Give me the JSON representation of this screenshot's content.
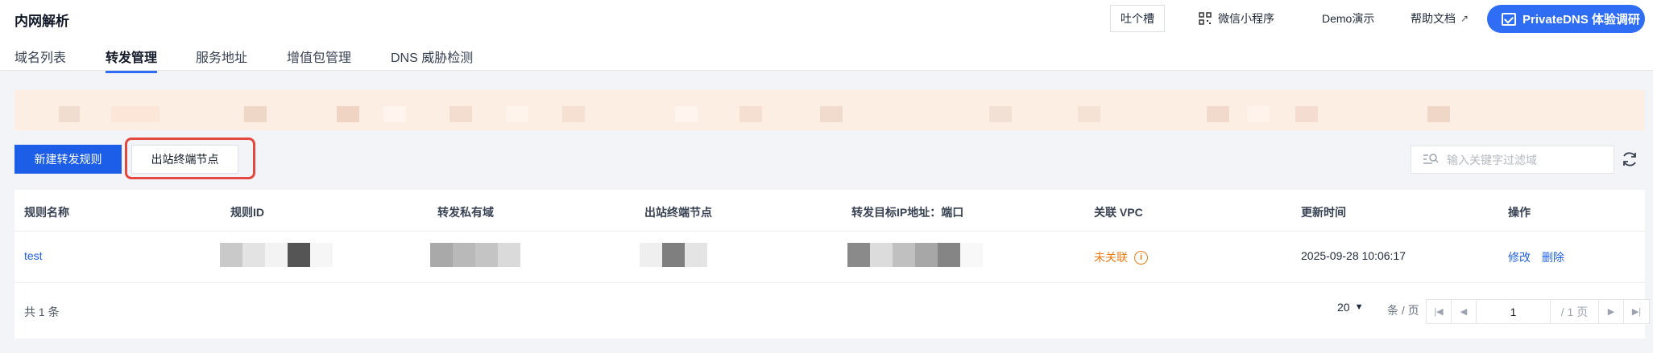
{
  "header": {
    "title": "内网解析",
    "feedback_label": "吐个槽",
    "miniprogram_label": "微信小程序",
    "demo_label": "Demo演示",
    "docs_label": "帮助文档",
    "survey_label": "PrivateDNS 体验调研"
  },
  "tabs": [
    {
      "label": "域名列表"
    },
    {
      "label": "转发管理",
      "active": true
    },
    {
      "label": "服务地址"
    },
    {
      "label": "增值包管理"
    },
    {
      "label": "DNS 威胁检测"
    }
  ],
  "toolbar": {
    "create_label": "新建转发规则",
    "endpoint_label": "出站终端节点",
    "search_placeholder": "输入关键字过滤域",
    "refresh_icon": "refresh-icon"
  },
  "table": {
    "columns": [
      "规则名称",
      "规则ID",
      "转发私有域",
      "出站终端节点",
      "转发目标IP地址：端口",
      "关联 VPC",
      "更新时间",
      "操作"
    ],
    "rows": [
      {
        "name": "test",
        "vpc_status": "未关联",
        "updated": "2025-09-28 10:06:17",
        "action_edit": "修改",
        "action_delete": "删除"
      }
    ]
  },
  "footer": {
    "total": "共 1 条",
    "page_size": "20",
    "per_page": "条 / 页",
    "current_page": "1",
    "total_pages": "/ 1 页"
  },
  "colors": {
    "primary": "#1d5ee8",
    "survey": "#2e6df4",
    "warning": "#f07b13",
    "highlight": "#e5483e",
    "banner": "#fdeee3"
  }
}
